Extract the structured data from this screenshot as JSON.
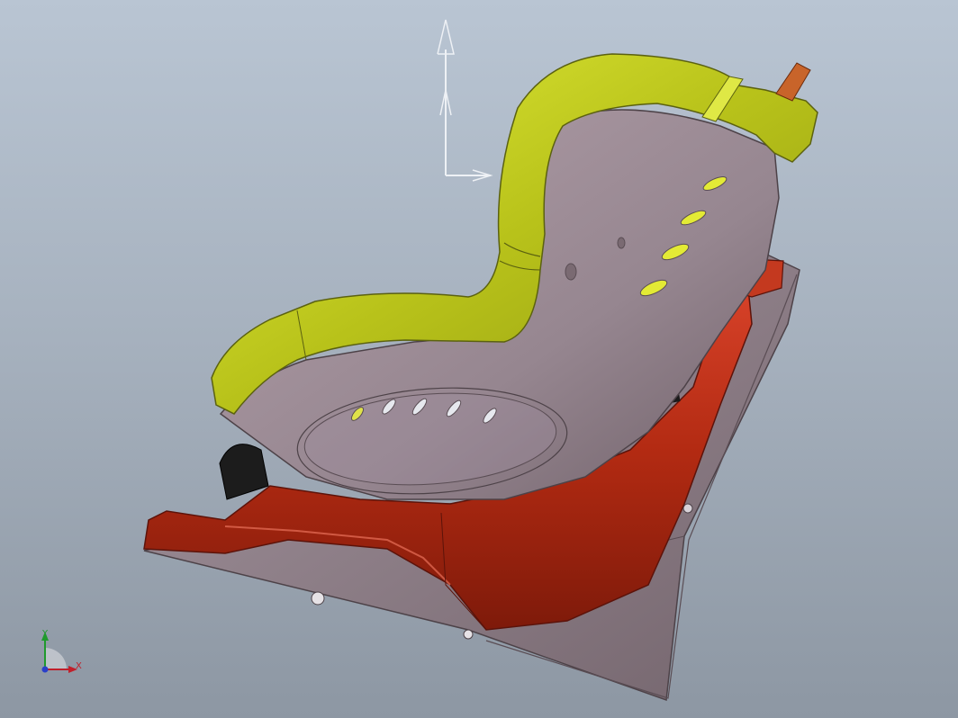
{
  "viewport": {
    "background_top": "#b9c5d3",
    "background_bottom": "#8d97a3"
  },
  "model": {
    "parts": [
      {
        "name": "shell",
        "color": "#9d8a94"
      },
      {
        "name": "padding",
        "color": "#b8c21a"
      },
      {
        "name": "base",
        "color": "#b22a12"
      },
      {
        "name": "recline-handle",
        "color": "#c8642a"
      }
    ]
  },
  "triad": {
    "x_label": "X",
    "y_label": "Y",
    "x_color": "#c0202b",
    "y_color": "#1f9a2c",
    "z_color": "#2a3fc9"
  }
}
